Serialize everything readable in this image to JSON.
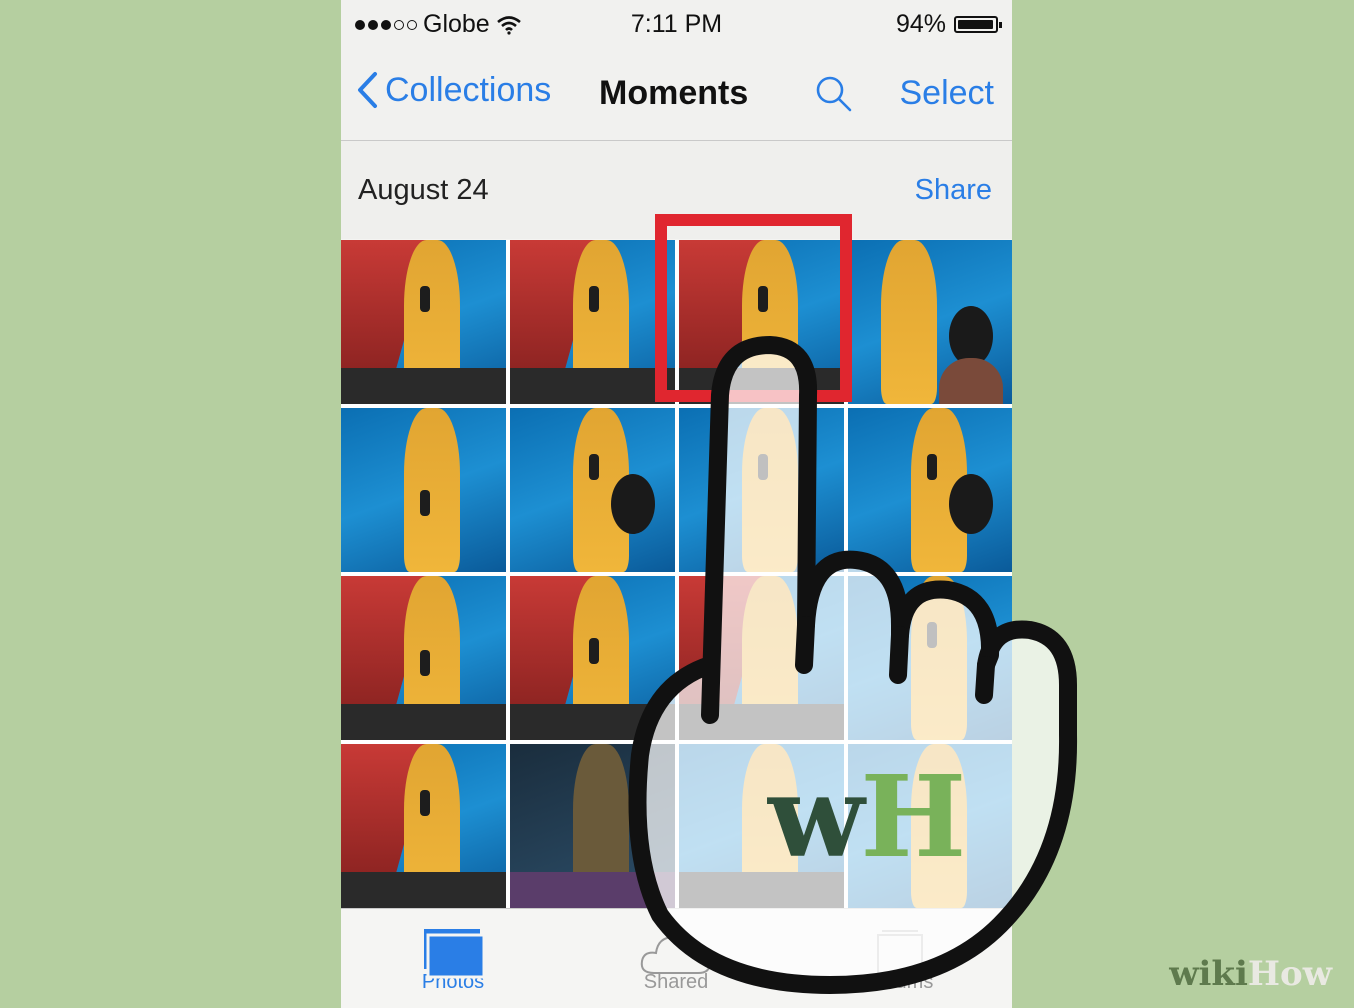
{
  "status_bar": {
    "carrier": "Globe",
    "time": "7:11 PM",
    "battery_percent": "94%",
    "signal_bars_filled": 3,
    "signal_bars_total": 5
  },
  "nav": {
    "back_label": "Collections",
    "title": "Moments",
    "select_label": "Select"
  },
  "section": {
    "date": "August 24",
    "share_label": "Share"
  },
  "tabs": [
    {
      "label": "Photos",
      "active": true
    },
    {
      "label": "Shared",
      "active": false
    },
    {
      "label": "Albums",
      "active": false
    }
  ],
  "photos_count": 16,
  "highlighted_photo_index": 2,
  "colors": {
    "ios_blue": "#2a7ee6",
    "highlight_red": "#e0262f",
    "background_green": "#b5cfa0"
  },
  "watermark": {
    "logo_w": "w",
    "logo_h": "H",
    "brand_wiki": "wiki",
    "brand_how": "How"
  }
}
